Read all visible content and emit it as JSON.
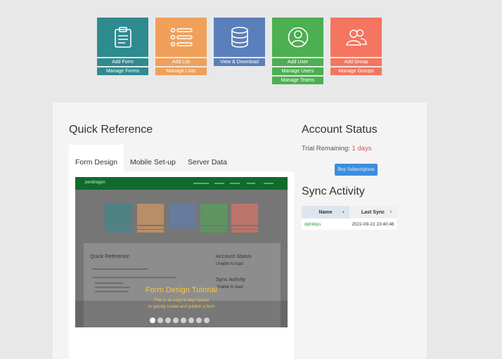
{
  "tiles": [
    {
      "icon": "form-icon",
      "color": "#2e8b8f",
      "actions": [
        "Add Form",
        "Manage Forms"
      ]
    },
    {
      "icon": "list-icon",
      "color": "#f0a05a",
      "actions": [
        "Add List",
        "Manage Lists"
      ]
    },
    {
      "icon": "database-icon",
      "color": "#5b7fbb",
      "actions": [
        "View & Download"
      ]
    },
    {
      "icon": "user-icon",
      "color": "#4caf50",
      "actions": [
        "Add User",
        "Manage Users",
        "Manage Teams"
      ]
    },
    {
      "icon": "group-icon",
      "color": "#f47560",
      "actions": [
        "Add Group",
        "Manage Groups"
      ]
    }
  ],
  "quick_reference": {
    "title": "Quick Reference",
    "tabs": [
      "Form Design",
      "Mobile Set-up",
      "Server Data"
    ],
    "active_tab": "Form Design",
    "carousel": {
      "caption_title": "Form Design Tutorial",
      "caption_line1": "This is an easy 6-step tutorial",
      "caption_line2": "to quickly create and publish a form",
      "slide_count": 8,
      "active_slide": 1,
      "preview": {
        "logo": "pendragon",
        "title": "Quick Reference",
        "account_title": "Account Status",
        "account_text": "Unable to load",
        "sync_title": "Sync Activity",
        "sync_text": "Unable to load"
      }
    }
  },
  "account_status": {
    "title": "Account Status",
    "trial_label": "Trial Remaining:",
    "trial_value": "1 days",
    "buy_button": "Buy Subscription"
  },
  "sync_activity": {
    "title": "Sync Activity",
    "columns": [
      "Name",
      "Last Sync"
    ],
    "sort_indicators": [
      "▲",
      "⇕"
    ],
    "rows": [
      {
        "name": "dphillips",
        "last_sync": "2022-09-22 23:40:46"
      }
    ]
  },
  "colors": {
    "accent": "#3c8dde",
    "trial_days": "#d9534f",
    "user_link": "#2e9e3e",
    "caption": "#f5c842"
  }
}
